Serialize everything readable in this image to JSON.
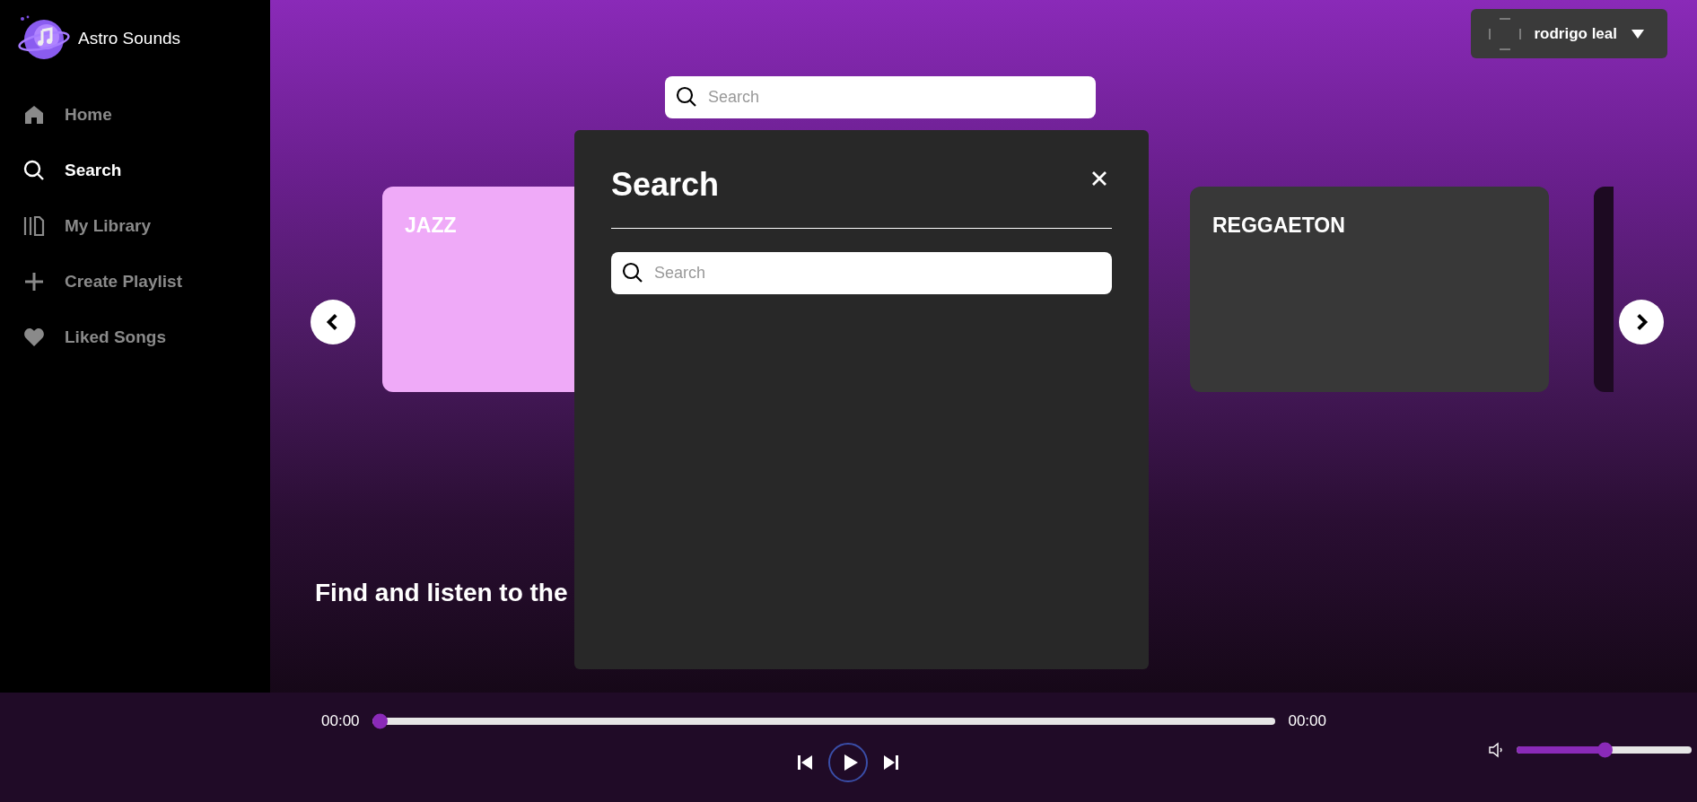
{
  "brand": {
    "name": "Astro Sounds"
  },
  "sidebar": {
    "items": [
      {
        "label": "Home",
        "kind": "home",
        "selected": false
      },
      {
        "label": "Search",
        "kind": "search",
        "selected": true
      },
      {
        "label": "My Library",
        "kind": "library",
        "selected": false
      },
      {
        "label": "Create Playlist",
        "kind": "plus",
        "selected": false
      },
      {
        "label": "Liked Songs",
        "kind": "heart",
        "selected": false
      }
    ]
  },
  "user": {
    "name": "rodrigo leal"
  },
  "search": {
    "placeholder": "Search"
  },
  "genres": [
    {
      "label": "JAZZ",
      "color": "#efaaf8"
    },
    {
      "label": "REGGAETON",
      "color": "#383838"
    }
  ],
  "tagline": "Find and listen to the",
  "modal": {
    "title": "Search",
    "placeholder": "Search"
  },
  "player": {
    "elapsed": "00:00",
    "duration": "00:00",
    "level": 0,
    "volume": {
      "level": 0.5
    }
  }
}
